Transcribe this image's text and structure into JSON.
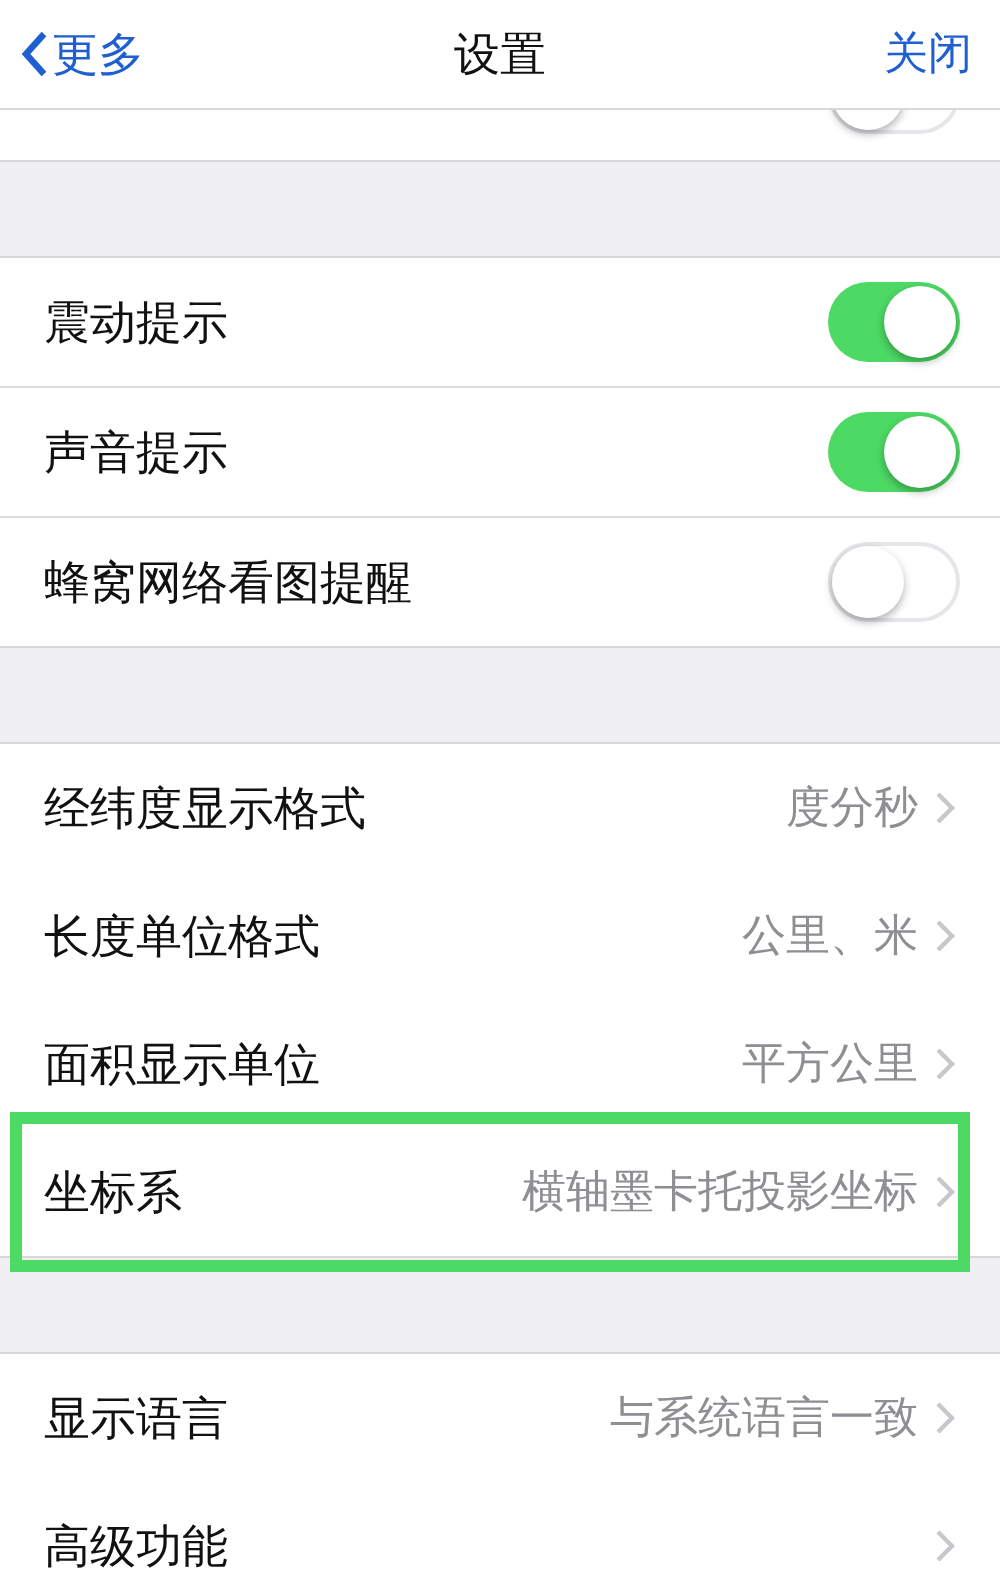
{
  "nav_bar": {
    "back_label": "更多",
    "title": "设置",
    "close_label": "关闭"
  },
  "partial_row": {
    "on": false
  },
  "groups": [
    {
      "rows": [
        {
          "kind": "toggle",
          "label": "震动提示",
          "on": true
        },
        {
          "kind": "toggle",
          "label": "声音提示",
          "on": true
        },
        {
          "kind": "toggle",
          "label": "蜂窝网络看图提醒",
          "on": false
        }
      ]
    },
    {
      "rows": [
        {
          "kind": "link",
          "label": "经纬度显示格式",
          "value": "度分秒",
          "highlighted": false
        },
        {
          "kind": "link",
          "label": "长度单位格式",
          "value": "公里、米",
          "highlighted": false
        },
        {
          "kind": "link",
          "label": "面积显示单位",
          "value": "平方公里",
          "highlighted": false
        },
        {
          "kind": "link",
          "label": "坐标系",
          "value": "横轴墨卡托投影坐标",
          "highlighted": true
        }
      ]
    },
    {
      "rows": [
        {
          "kind": "link",
          "label": "显示语言",
          "value": "与系统语言一致",
          "highlighted": false
        },
        {
          "kind": "link",
          "label": "高级功能",
          "highlighted": false
        }
      ]
    }
  ]
}
